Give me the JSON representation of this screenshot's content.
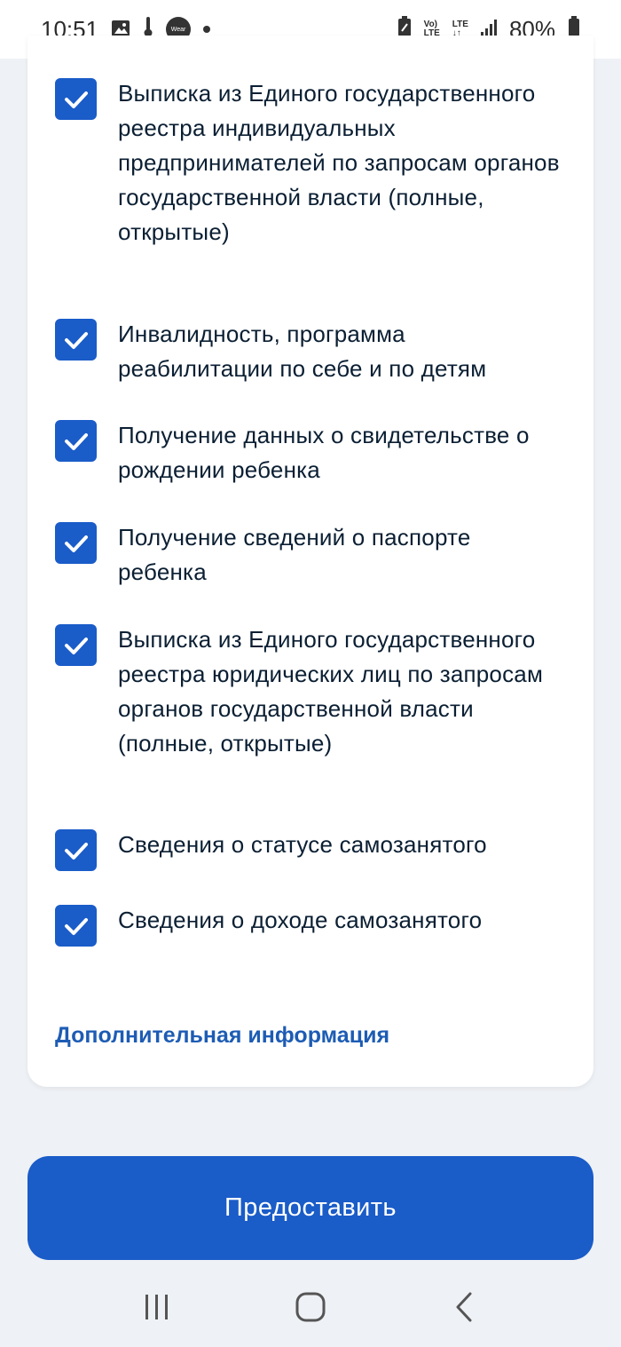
{
  "status_bar": {
    "time": "10:51",
    "battery": "80%",
    "wear_label": "Wear",
    "volte_top": "Vo)",
    "volte_bottom": "LTE",
    "lte_top": "LTE",
    "lte_bottom": "↓↑"
  },
  "items": [
    {
      "label": "Выписка из Единого государственного реестра индивидуальных предпринимателей по запросам органов государственной власти (полные, открытые)",
      "checked": true
    },
    {
      "label": "Инвалидность, программа реабилитации по себе и по детям",
      "checked": true
    },
    {
      "label": "Получение данных о свидетельстве о рождении ребенка",
      "checked": true
    },
    {
      "label": "Получение сведений о паспорте ребенка",
      "checked": true
    },
    {
      "label": "Выписка из Единого государственного реестра юридических лиц по запросам органов государственной власти (полные, открытые)",
      "checked": true
    },
    {
      "label": "Сведения о статусе самозанятого",
      "checked": true
    },
    {
      "label": "Сведения о доходе самозанятого",
      "checked": true
    }
  ],
  "more_info_link": "Дополнительная информация",
  "submit_label": "Предоставить",
  "colors": {
    "accent": "#1a5cc8",
    "link": "#1d5cb4",
    "text": "#0b1f33",
    "background": "#eef1f5"
  }
}
